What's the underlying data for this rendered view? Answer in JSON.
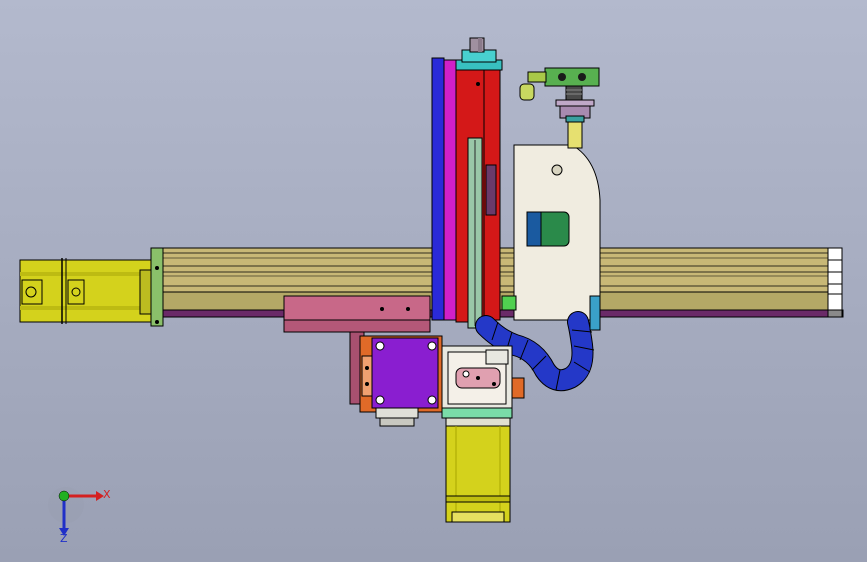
{
  "viewport": {
    "background_top": "#b3b9cd",
    "background_bottom": "#9ea4b8"
  },
  "triad": {
    "x_label": "X",
    "z_label": "Z",
    "x_color": "#d42020",
    "y_color": "#22b022",
    "z_color": "#2030c8"
  },
  "colors": {
    "motor_yellow": "#d4d21c",
    "rail_tan": "#c8b876",
    "bracket_pink": "#c86888",
    "plate_purple": "#8a1ed0",
    "plate_orange": "#e06a28",
    "column_blue": "#2a2ad8",
    "column_magenta": "#d020c8",
    "column_red": "#d41818",
    "cable_blue": "#2438c8",
    "fixture_cream": "#f0ece0",
    "teal": "#2aa0a0",
    "green_block": "#2a8a4a"
  }
}
